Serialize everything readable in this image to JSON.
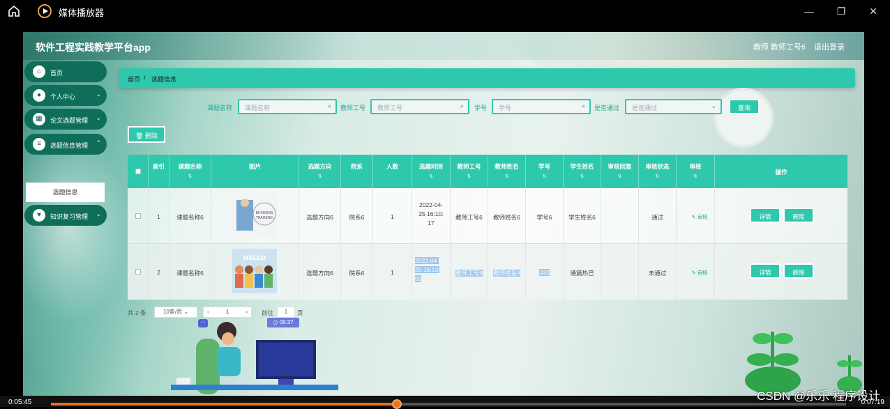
{
  "player": {
    "title": "媒体播放器",
    "time_current": "0:05:45",
    "time_total": "0:07:19",
    "progress": 0.435
  },
  "app": {
    "brand": "软件工程实践教学平台app",
    "user_info": "教师 教师工号6",
    "logout": "退出登录"
  },
  "sidebar": {
    "items": [
      {
        "label": "首页"
      },
      {
        "label": "个人中心"
      },
      {
        "label": "论文选题管理"
      },
      {
        "label": "选题信息管理"
      },
      {
        "label": "知识复习管理"
      }
    ],
    "sub_item": "选题信息"
  },
  "breadcrumb": {
    "home": "首页",
    "sep": "/",
    "current": "选题信息"
  },
  "filters": {
    "title_label": "课题名称",
    "title_placeholder": "课题名称",
    "teacher_label": "教师工号",
    "teacher_placeholder": "教师工号",
    "student_label": "学号",
    "student_placeholder": "学号",
    "pass_label": "是否通过",
    "pass_placeholder": "是否通过",
    "query": "查询"
  },
  "toolbar": {
    "delete": "删除"
  },
  "table": {
    "headers": [
      "索引",
      "课题名称",
      "图片",
      "选题方向",
      "院系",
      "人数",
      "选题时间",
      "教师工号",
      "教师姓名",
      "学号",
      "学生姓名",
      "审核回复",
      "审核状态",
      "审核",
      "操作"
    ],
    "rows": [
      {
        "index": "1",
        "title": "课题名称6",
        "direction": "选题方向6",
        "dept": "院系6",
        "count": "1",
        "time_lines": [
          "2022-04-",
          "25 16:10:",
          "17"
        ],
        "teacher_no": "教师工号6",
        "teacher_name": "教师姓名6",
        "student_no": "学号6",
        "student_name": "学生姓名6",
        "reply": "",
        "status": "通过",
        "audit": "审核"
      },
      {
        "index": "2",
        "title": "课题名称6",
        "direction": "选题方向6",
        "dept": "院系6",
        "count": "1",
        "time_lines": [
          "2022-04-",
          "25 16:13:",
          "55"
        ],
        "teacher_no": "教师工号6",
        "teacher_name": "教师姓名6",
        "student_no": "333",
        "student_name": "通篇热巴",
        "reply": "",
        "status": "未通过",
        "audit": "审核"
      }
    ],
    "detail": "详情",
    "delete": "删除"
  },
  "pager": {
    "total": "共 2 条",
    "page_size": "10条/页",
    "page": "1",
    "goto_label": "前往",
    "goto_value": "1",
    "goto_suffix": "页"
  },
  "badge_time": "09:37",
  "watermark": "CSDN @乐乐 程序设计"
}
